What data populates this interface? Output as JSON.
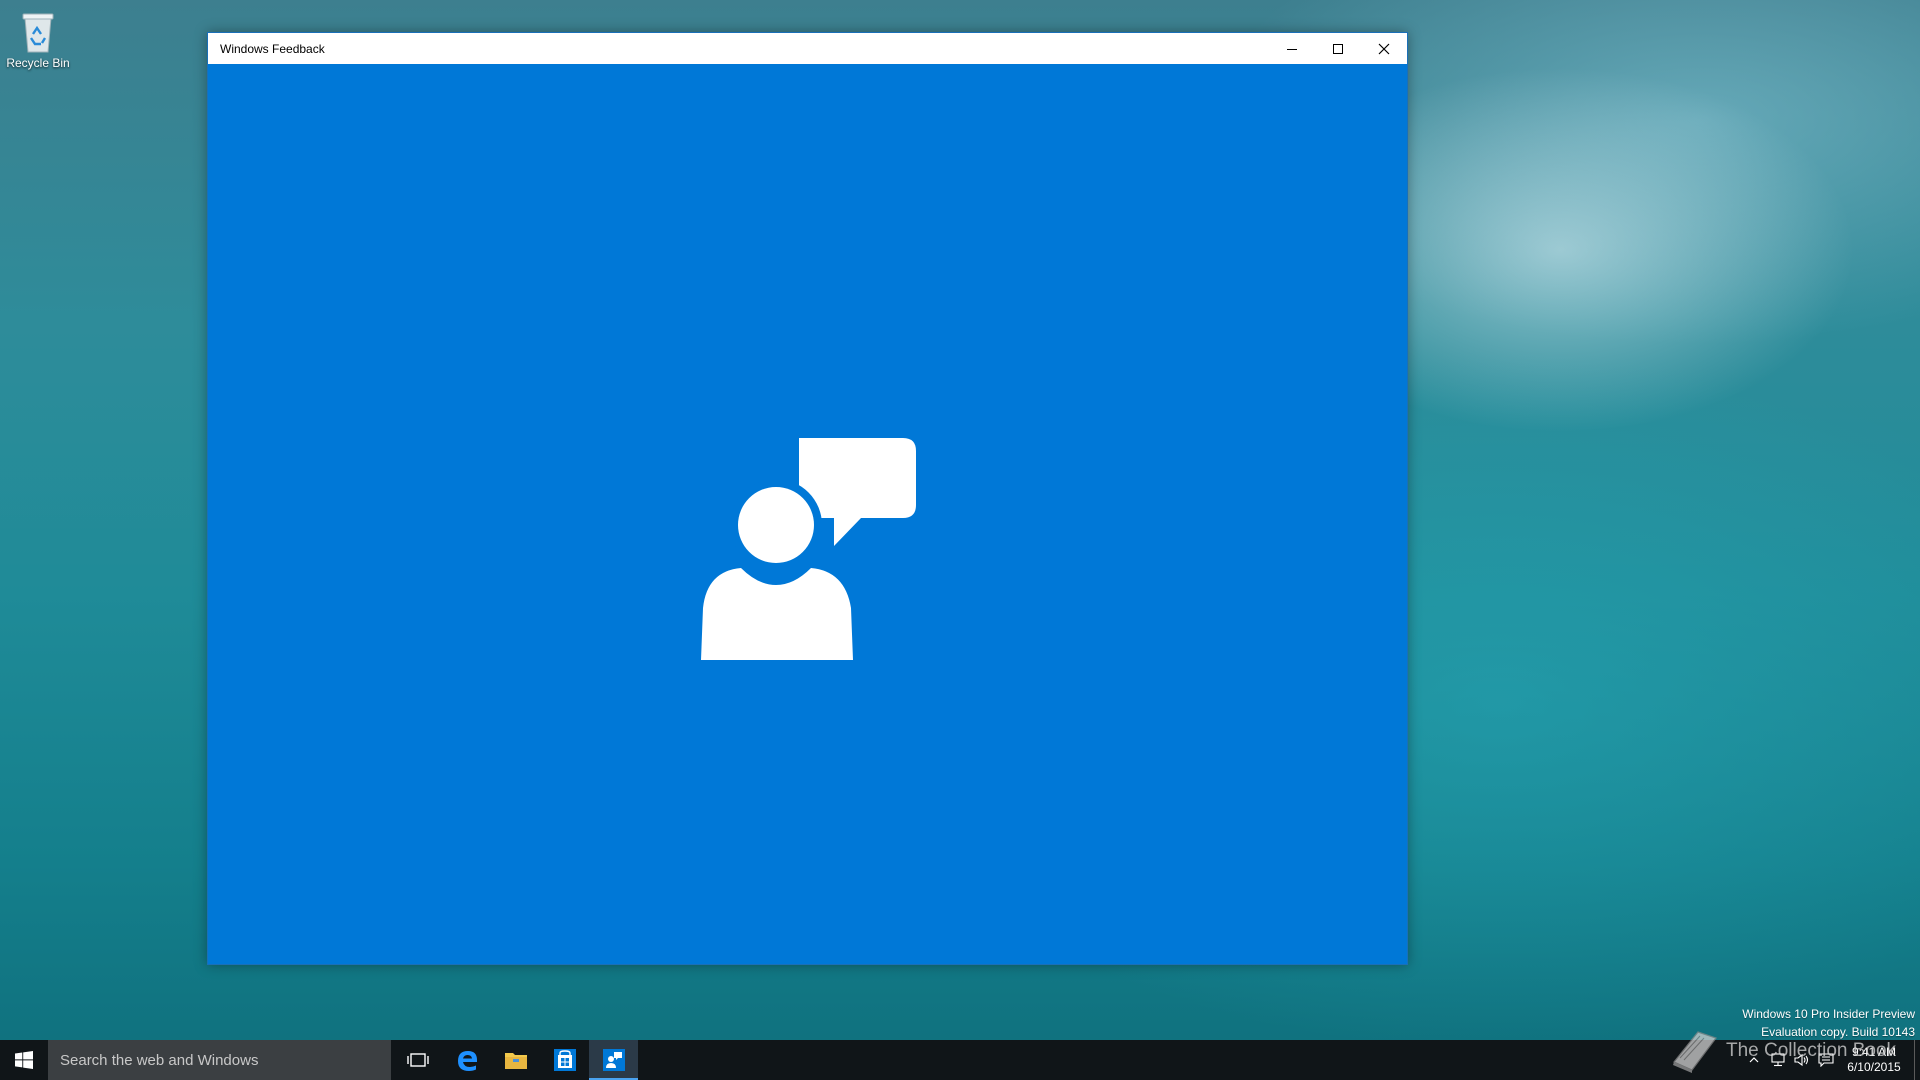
{
  "desktop": {
    "icons": [
      {
        "label": "Recycle Bin",
        "icon": "recycle-bin-icon"
      }
    ]
  },
  "window": {
    "title": "Windows Feedback",
    "caption": {
      "minimize_icon": "minimize-icon",
      "maximize_icon": "maximize-icon",
      "close_icon": "close-icon"
    },
    "background_color": "#0078d7",
    "splash_icon": "person-feedback-icon"
  },
  "watermark": {
    "line1": "Windows 10 Pro Insider Preview",
    "line2": "Evaluation copy. Build 10143"
  },
  "brand_watermark": {
    "text": "The Collection Book",
    "icon": "book-icon"
  },
  "taskbar": {
    "start_icon": "windows-logo-icon",
    "search_placeholder": "Search the web and Windows",
    "apps": [
      {
        "name": "Task View",
        "icon": "task-view-icon"
      },
      {
        "name": "Microsoft Edge",
        "icon": "edge-icon"
      },
      {
        "name": "File Explorer",
        "icon": "folder-icon"
      },
      {
        "name": "Store",
        "icon": "store-icon"
      },
      {
        "name": "Windows Feedback",
        "icon": "feedback-icon",
        "active": true
      }
    ],
    "tray": {
      "icons": [
        "chevron-up-icon",
        "network-icon",
        "volume-icon",
        "action-center-icon"
      ],
      "time": "9:41 AM",
      "date": "6/10/2015"
    },
    "colors": {
      "background": "#101518",
      "search": "#3b3f42",
      "accent": "#4aa3f0"
    }
  }
}
